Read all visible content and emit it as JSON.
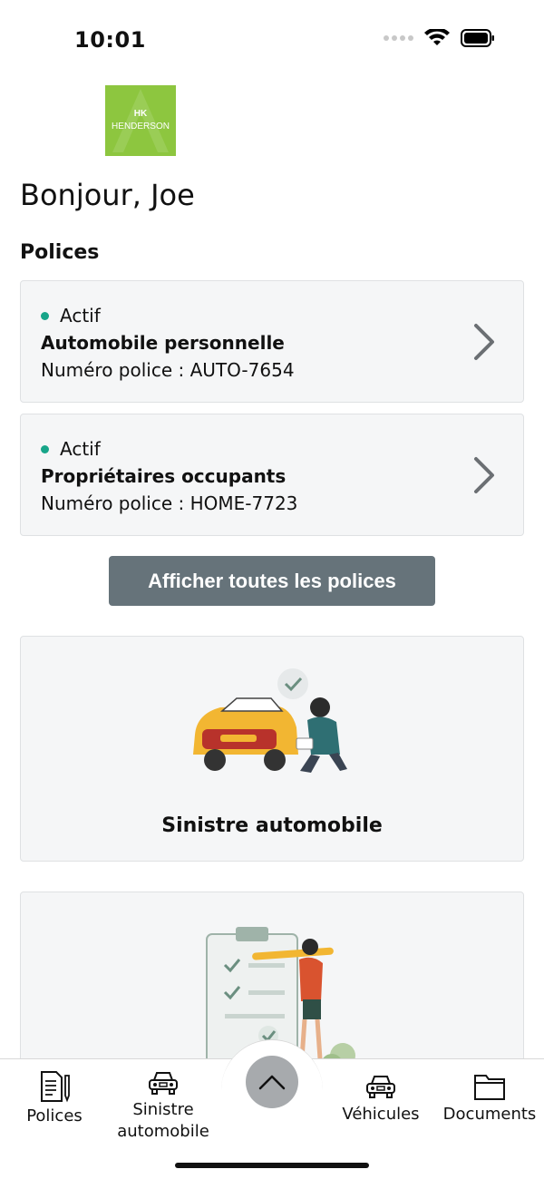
{
  "status_bar": {
    "time": "10:01"
  },
  "brand": {
    "mark": "HK",
    "name": "HENDERSON",
    "color": "#8dc63f"
  },
  "greeting": "Bonjour, Joe",
  "policies_section": {
    "title": "Polices"
  },
  "policies": [
    {
      "status": "Actif",
      "title": "Automobile personnelle",
      "number": "Numéro police : AUTO-7654"
    },
    {
      "status": "Actif",
      "title": "Propriétaires occupants",
      "number": "Numéro police : HOME-7723"
    }
  ],
  "show_all_button": "Afficher toutes les polices",
  "tiles": [
    {
      "label": "Sinistre automobile",
      "icon": "car-claim-illustration"
    },
    {
      "label": "",
      "icon": "checklist-illustration"
    }
  ],
  "tabbar": {
    "items": [
      {
        "label": "Polices",
        "icon": "document-pencil-icon"
      },
      {
        "label": "Sinistre automobile",
        "icon": "car-icon"
      },
      {
        "label": "Véhicules",
        "icon": "car-icon"
      },
      {
        "label": "Documents",
        "icon": "folder-icon"
      }
    ],
    "fab_icon": "chevron-up-icon"
  },
  "colors": {
    "active": "#17a589",
    "button": "#66737a",
    "card_bg": "#f5f6f7"
  }
}
